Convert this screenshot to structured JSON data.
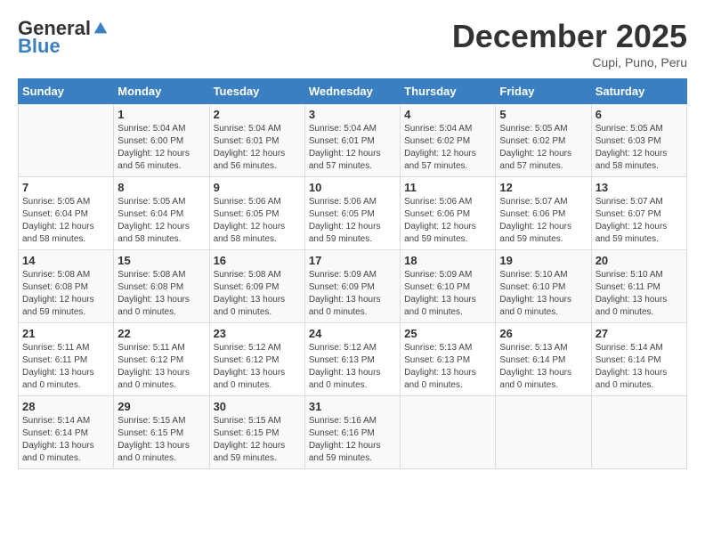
{
  "header": {
    "logo_general": "General",
    "logo_blue": "Blue",
    "month": "December 2025",
    "location": "Cupi, Puno, Peru"
  },
  "days_of_week": [
    "Sunday",
    "Monday",
    "Tuesday",
    "Wednesday",
    "Thursday",
    "Friday",
    "Saturday"
  ],
  "weeks": [
    [
      {
        "day": "",
        "info": ""
      },
      {
        "day": "1",
        "info": "Sunrise: 5:04 AM\nSunset: 6:00 PM\nDaylight: 12 hours\nand 56 minutes."
      },
      {
        "day": "2",
        "info": "Sunrise: 5:04 AM\nSunset: 6:01 PM\nDaylight: 12 hours\nand 56 minutes."
      },
      {
        "day": "3",
        "info": "Sunrise: 5:04 AM\nSunset: 6:01 PM\nDaylight: 12 hours\nand 57 minutes."
      },
      {
        "day": "4",
        "info": "Sunrise: 5:04 AM\nSunset: 6:02 PM\nDaylight: 12 hours\nand 57 minutes."
      },
      {
        "day": "5",
        "info": "Sunrise: 5:05 AM\nSunset: 6:02 PM\nDaylight: 12 hours\nand 57 minutes."
      },
      {
        "day": "6",
        "info": "Sunrise: 5:05 AM\nSunset: 6:03 PM\nDaylight: 12 hours\nand 58 minutes."
      }
    ],
    [
      {
        "day": "7",
        "info": "Sunrise: 5:05 AM\nSunset: 6:04 PM\nDaylight: 12 hours\nand 58 minutes."
      },
      {
        "day": "8",
        "info": "Sunrise: 5:05 AM\nSunset: 6:04 PM\nDaylight: 12 hours\nand 58 minutes."
      },
      {
        "day": "9",
        "info": "Sunrise: 5:06 AM\nSunset: 6:05 PM\nDaylight: 12 hours\nand 58 minutes."
      },
      {
        "day": "10",
        "info": "Sunrise: 5:06 AM\nSunset: 6:05 PM\nDaylight: 12 hours\nand 59 minutes."
      },
      {
        "day": "11",
        "info": "Sunrise: 5:06 AM\nSunset: 6:06 PM\nDaylight: 12 hours\nand 59 minutes."
      },
      {
        "day": "12",
        "info": "Sunrise: 5:07 AM\nSunset: 6:06 PM\nDaylight: 12 hours\nand 59 minutes."
      },
      {
        "day": "13",
        "info": "Sunrise: 5:07 AM\nSunset: 6:07 PM\nDaylight: 12 hours\nand 59 minutes."
      }
    ],
    [
      {
        "day": "14",
        "info": "Sunrise: 5:08 AM\nSunset: 6:08 PM\nDaylight: 12 hours\nand 59 minutes."
      },
      {
        "day": "15",
        "info": "Sunrise: 5:08 AM\nSunset: 6:08 PM\nDaylight: 13 hours\nand 0 minutes."
      },
      {
        "day": "16",
        "info": "Sunrise: 5:08 AM\nSunset: 6:09 PM\nDaylight: 13 hours\nand 0 minutes."
      },
      {
        "day": "17",
        "info": "Sunrise: 5:09 AM\nSunset: 6:09 PM\nDaylight: 13 hours\nand 0 minutes."
      },
      {
        "day": "18",
        "info": "Sunrise: 5:09 AM\nSunset: 6:10 PM\nDaylight: 13 hours\nand 0 minutes."
      },
      {
        "day": "19",
        "info": "Sunrise: 5:10 AM\nSunset: 6:10 PM\nDaylight: 13 hours\nand 0 minutes."
      },
      {
        "day": "20",
        "info": "Sunrise: 5:10 AM\nSunset: 6:11 PM\nDaylight: 13 hours\nand 0 minutes."
      }
    ],
    [
      {
        "day": "21",
        "info": "Sunrise: 5:11 AM\nSunset: 6:11 PM\nDaylight: 13 hours\nand 0 minutes."
      },
      {
        "day": "22",
        "info": "Sunrise: 5:11 AM\nSunset: 6:12 PM\nDaylight: 13 hours\nand 0 minutes."
      },
      {
        "day": "23",
        "info": "Sunrise: 5:12 AM\nSunset: 6:12 PM\nDaylight: 13 hours\nand 0 minutes."
      },
      {
        "day": "24",
        "info": "Sunrise: 5:12 AM\nSunset: 6:13 PM\nDaylight: 13 hours\nand 0 minutes."
      },
      {
        "day": "25",
        "info": "Sunrise: 5:13 AM\nSunset: 6:13 PM\nDaylight: 13 hours\nand 0 minutes."
      },
      {
        "day": "26",
        "info": "Sunrise: 5:13 AM\nSunset: 6:14 PM\nDaylight: 13 hours\nand 0 minutes."
      },
      {
        "day": "27",
        "info": "Sunrise: 5:14 AM\nSunset: 6:14 PM\nDaylight: 13 hours\nand 0 minutes."
      }
    ],
    [
      {
        "day": "28",
        "info": "Sunrise: 5:14 AM\nSunset: 6:14 PM\nDaylight: 13 hours\nand 0 minutes."
      },
      {
        "day": "29",
        "info": "Sunrise: 5:15 AM\nSunset: 6:15 PM\nDaylight: 13 hours\nand 0 minutes."
      },
      {
        "day": "30",
        "info": "Sunrise: 5:15 AM\nSunset: 6:15 PM\nDaylight: 12 hours\nand 59 minutes."
      },
      {
        "day": "31",
        "info": "Sunrise: 5:16 AM\nSunset: 6:16 PM\nDaylight: 12 hours\nand 59 minutes."
      },
      {
        "day": "",
        "info": ""
      },
      {
        "day": "",
        "info": ""
      },
      {
        "day": "",
        "info": ""
      }
    ]
  ]
}
